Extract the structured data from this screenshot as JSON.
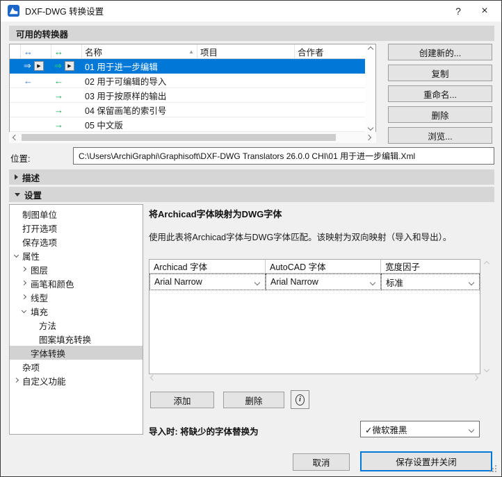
{
  "window": {
    "title": "DXF-DWG 转换设置",
    "help": "?",
    "close": "×"
  },
  "available_translators": {
    "header": "可用的转换器",
    "columns": {
      "name": "名称",
      "project": "项目",
      "collaborator": "合作者"
    },
    "rows": [
      {
        "blue_arrow": "⇒",
        "green_arrow": "⇒",
        "name": "01 用于进一步编辑",
        "selected": true
      },
      {
        "blue_arrow": "←",
        "green_arrow": "←",
        "name": "02 用于可编辑的导入",
        "selected": false
      },
      {
        "blue_arrow": "",
        "green_arrow": "→",
        "name": "03 用于按原样的输出",
        "selected": false
      },
      {
        "blue_arrow": "",
        "green_arrow": "→",
        "name": "04 保留画笔的索引号",
        "selected": false
      },
      {
        "blue_arrow": "",
        "green_arrow": "→",
        "name": "05 中文版",
        "selected": false
      }
    ],
    "buttons": {
      "create": "创建新的...",
      "duplicate": "复制",
      "rename": "重命名...",
      "delete": "删除",
      "browse": "浏览..."
    }
  },
  "location": {
    "label": "位置:",
    "path": "C:\\Users\\ArchiGraphi\\Graphisoft\\DXF-DWG Translators 26.0.0 CHI\\01 用于进一步编辑.Xml"
  },
  "description_section": {
    "label": "描述"
  },
  "settings_section": {
    "label": "设置"
  },
  "settings_tree": {
    "items": [
      {
        "label": "制图单位"
      },
      {
        "label": "打开选项"
      },
      {
        "label": "保存选项"
      },
      {
        "label": "属性"
      },
      {
        "label": "图层"
      },
      {
        "label": "画笔和颜色"
      },
      {
        "label": "线型"
      },
      {
        "label": "填充"
      },
      {
        "label": "方法"
      },
      {
        "label": "图案填充转换"
      },
      {
        "label": "字体转换"
      },
      {
        "label": "杂项"
      },
      {
        "label": "自定义功能"
      }
    ],
    "selected": "字体转换"
  },
  "font_mapping": {
    "title": "将Archicad字体映射为DWG字体",
    "description": "使用此表将Archicad字体与DWG字体匹配。该映射为双向映射（导入和导出）。",
    "columns": {
      "archicad": "Archicad 字体",
      "autocad": "AutoCAD 字体",
      "width_factor": "宽度因子"
    },
    "row": {
      "archicad_font": "Arial Narrow",
      "autocad_font": "Arial Narrow",
      "width_factor": "标准"
    },
    "add_button": "添加",
    "delete_button": "删除",
    "info_icon": "i",
    "import_label": "导入时: 将缺少的字体替换为",
    "missing_font_replacement": "✓微软雅黑"
  },
  "footer": {
    "cancel": "取消",
    "save": "保存设置并关闭"
  },
  "icons": {
    "bidirectional": "↔",
    "play": "▶",
    "sort_ascending": "▲"
  },
  "colors": {
    "selection_blue": "#0078d7",
    "arrow_green": "#0ca750",
    "arrow_blue": "#2e74d6",
    "accent": "#0078d7"
  }
}
